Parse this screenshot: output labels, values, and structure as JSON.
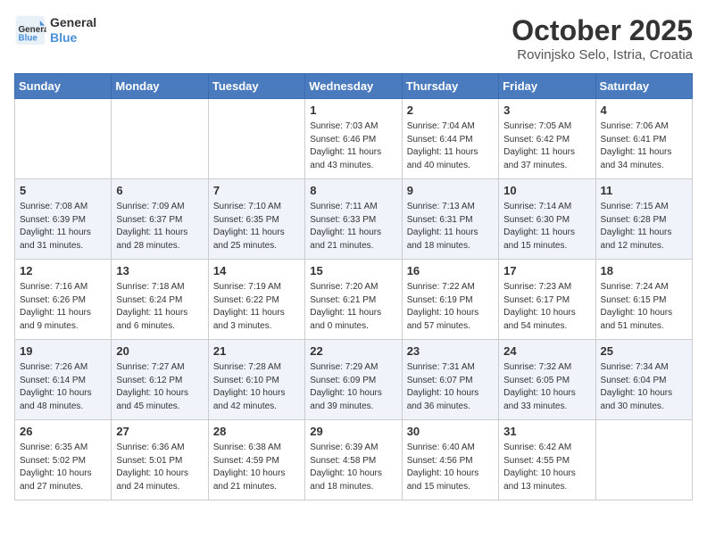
{
  "logo": {
    "line1": "General",
    "line2": "Blue"
  },
  "title": "October 2025",
  "subtitle": "Rovinjsko Selo, Istria, Croatia",
  "weekdays": [
    "Sunday",
    "Monday",
    "Tuesday",
    "Wednesday",
    "Thursday",
    "Friday",
    "Saturday"
  ],
  "weeks": [
    [
      {
        "day": "",
        "info": ""
      },
      {
        "day": "",
        "info": ""
      },
      {
        "day": "",
        "info": ""
      },
      {
        "day": "1",
        "info": "Sunrise: 7:03 AM\nSunset: 6:46 PM\nDaylight: 11 hours\nand 43 minutes."
      },
      {
        "day": "2",
        "info": "Sunrise: 7:04 AM\nSunset: 6:44 PM\nDaylight: 11 hours\nand 40 minutes."
      },
      {
        "day": "3",
        "info": "Sunrise: 7:05 AM\nSunset: 6:42 PM\nDaylight: 11 hours\nand 37 minutes."
      },
      {
        "day": "4",
        "info": "Sunrise: 7:06 AM\nSunset: 6:41 PM\nDaylight: 11 hours\nand 34 minutes."
      }
    ],
    [
      {
        "day": "5",
        "info": "Sunrise: 7:08 AM\nSunset: 6:39 PM\nDaylight: 11 hours\nand 31 minutes."
      },
      {
        "day": "6",
        "info": "Sunrise: 7:09 AM\nSunset: 6:37 PM\nDaylight: 11 hours\nand 28 minutes."
      },
      {
        "day": "7",
        "info": "Sunrise: 7:10 AM\nSunset: 6:35 PM\nDaylight: 11 hours\nand 25 minutes."
      },
      {
        "day": "8",
        "info": "Sunrise: 7:11 AM\nSunset: 6:33 PM\nDaylight: 11 hours\nand 21 minutes."
      },
      {
        "day": "9",
        "info": "Sunrise: 7:13 AM\nSunset: 6:31 PM\nDaylight: 11 hours\nand 18 minutes."
      },
      {
        "day": "10",
        "info": "Sunrise: 7:14 AM\nSunset: 6:30 PM\nDaylight: 11 hours\nand 15 minutes."
      },
      {
        "day": "11",
        "info": "Sunrise: 7:15 AM\nSunset: 6:28 PM\nDaylight: 11 hours\nand 12 minutes."
      }
    ],
    [
      {
        "day": "12",
        "info": "Sunrise: 7:16 AM\nSunset: 6:26 PM\nDaylight: 11 hours\nand 9 minutes."
      },
      {
        "day": "13",
        "info": "Sunrise: 7:18 AM\nSunset: 6:24 PM\nDaylight: 11 hours\nand 6 minutes."
      },
      {
        "day": "14",
        "info": "Sunrise: 7:19 AM\nSunset: 6:22 PM\nDaylight: 11 hours\nand 3 minutes."
      },
      {
        "day": "15",
        "info": "Sunrise: 7:20 AM\nSunset: 6:21 PM\nDaylight: 11 hours\nand 0 minutes."
      },
      {
        "day": "16",
        "info": "Sunrise: 7:22 AM\nSunset: 6:19 PM\nDaylight: 10 hours\nand 57 minutes."
      },
      {
        "day": "17",
        "info": "Sunrise: 7:23 AM\nSunset: 6:17 PM\nDaylight: 10 hours\nand 54 minutes."
      },
      {
        "day": "18",
        "info": "Sunrise: 7:24 AM\nSunset: 6:15 PM\nDaylight: 10 hours\nand 51 minutes."
      }
    ],
    [
      {
        "day": "19",
        "info": "Sunrise: 7:26 AM\nSunset: 6:14 PM\nDaylight: 10 hours\nand 48 minutes."
      },
      {
        "day": "20",
        "info": "Sunrise: 7:27 AM\nSunset: 6:12 PM\nDaylight: 10 hours\nand 45 minutes."
      },
      {
        "day": "21",
        "info": "Sunrise: 7:28 AM\nSunset: 6:10 PM\nDaylight: 10 hours\nand 42 minutes."
      },
      {
        "day": "22",
        "info": "Sunrise: 7:29 AM\nSunset: 6:09 PM\nDaylight: 10 hours\nand 39 minutes."
      },
      {
        "day": "23",
        "info": "Sunrise: 7:31 AM\nSunset: 6:07 PM\nDaylight: 10 hours\nand 36 minutes."
      },
      {
        "day": "24",
        "info": "Sunrise: 7:32 AM\nSunset: 6:05 PM\nDaylight: 10 hours\nand 33 minutes."
      },
      {
        "day": "25",
        "info": "Sunrise: 7:34 AM\nSunset: 6:04 PM\nDaylight: 10 hours\nand 30 minutes."
      }
    ],
    [
      {
        "day": "26",
        "info": "Sunrise: 6:35 AM\nSunset: 5:02 PM\nDaylight: 10 hours\nand 27 minutes."
      },
      {
        "day": "27",
        "info": "Sunrise: 6:36 AM\nSunset: 5:01 PM\nDaylight: 10 hours\nand 24 minutes."
      },
      {
        "day": "28",
        "info": "Sunrise: 6:38 AM\nSunset: 4:59 PM\nDaylight: 10 hours\nand 21 minutes."
      },
      {
        "day": "29",
        "info": "Sunrise: 6:39 AM\nSunset: 4:58 PM\nDaylight: 10 hours\nand 18 minutes."
      },
      {
        "day": "30",
        "info": "Sunrise: 6:40 AM\nSunset: 4:56 PM\nDaylight: 10 hours\nand 15 minutes."
      },
      {
        "day": "31",
        "info": "Sunrise: 6:42 AM\nSunset: 4:55 PM\nDaylight: 10 hours\nand 13 minutes."
      },
      {
        "day": "",
        "info": ""
      }
    ]
  ]
}
